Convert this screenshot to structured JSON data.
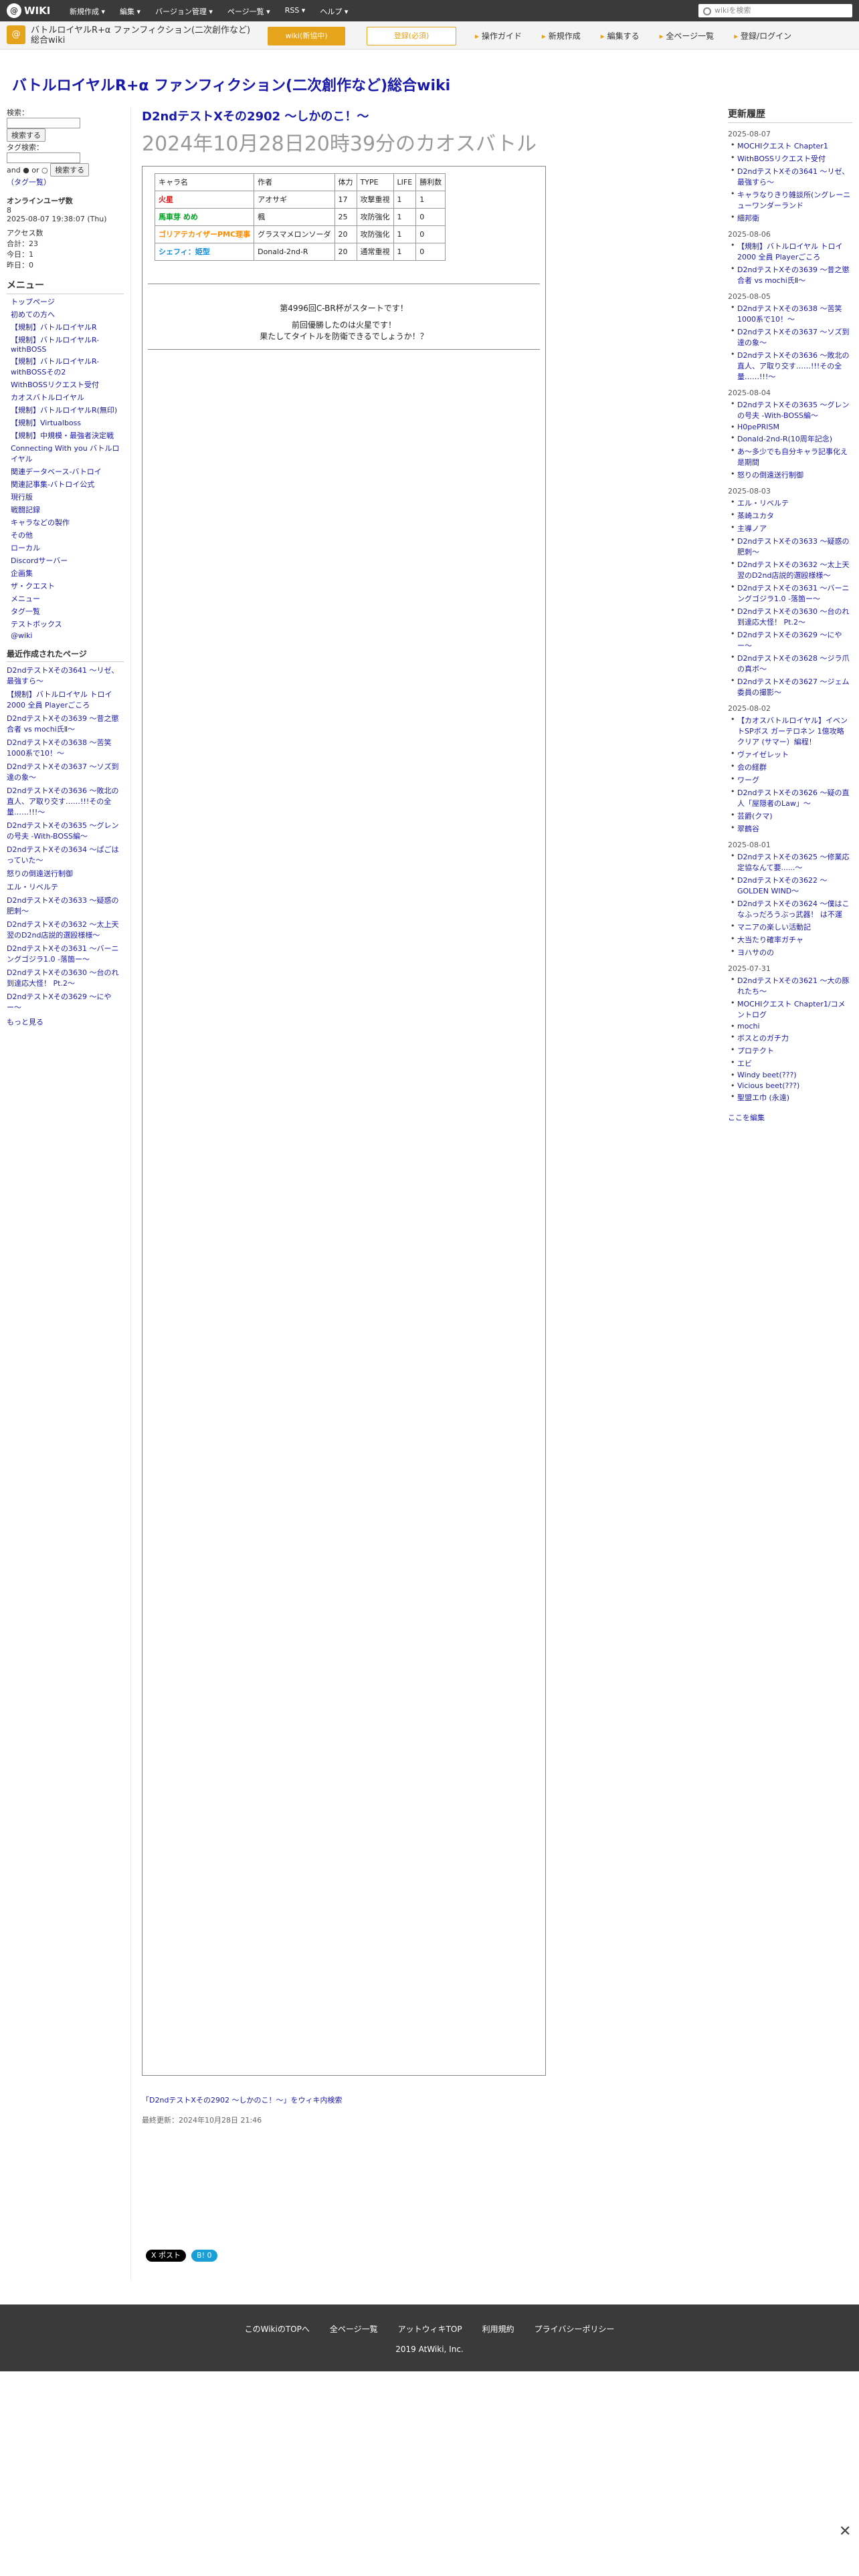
{
  "topbar": {
    "logo": "WIKI",
    "menus": [
      "新規作成 ▾",
      "編集 ▾",
      "バージョン管理 ▾",
      "ページ一覧 ▾",
      "RSS ▾",
      "ヘルプ ▾"
    ],
    "search_placeholder": "wikiを検索"
  },
  "subbar": {
    "site_title": "バトルロイヤルR+α ファンフィクション(二次創作など)総合wiki",
    "btn_wiki": "wiki(新協中)",
    "btn_register": "登録(必須)",
    "actions": [
      "操作ガイド",
      "新規作成",
      "編集する",
      "全ページ一覧",
      "登録/ログイン"
    ]
  },
  "wiki_title": "バトルロイヤルR+α ファンフィクション(二次創作など)総合wiki",
  "leftcol": {
    "search_label": "検索：",
    "search_btn": "検索する",
    "tag_label": "タグ検索：",
    "and_or": "and ● or ○",
    "search_btn2": "検索する",
    "tag_cloud": "（タグ一覧）",
    "online_label": "オンラインユーザ数",
    "online": "8",
    "date": "2025-08-07 19:38:07 (Thu)",
    "access": "アクセス数",
    "total": "合計：23",
    "today": "今日：1",
    "yesterday": "昨日：0",
    "menu_title": "メニュー",
    "nav": [
      "トップページ",
      "初めての方へ",
      "【規制】バトルロイヤルR",
      "【規制】バトルロイヤルR-withBOSS",
      "【規制】バトルロイヤルR-withBOSSその2",
      "WithBOSSリクエスト受付",
      "カオスバトルロイヤル",
      "【規制】バトルロイヤルR(無印)",
      "【規制】Virtualboss",
      "【規制】中規模・最強者決定戦",
      "Connecting With you バトルロイヤル",
      "関連データベース-バトロイ",
      "関連記事集-バトロイ公式",
      "現行版",
      "戦闘記録",
      "キャラなどの製作",
      "その他",
      "ローカル",
      "Discordサーバー",
      "企画集",
      "ザ・クエスト",
      "メニュー",
      "タグ一覧",
      "テストボックス",
      "@wiki"
    ],
    "recent_title": "最近作成されたページ",
    "recent": [
      "D2ndテストXその3641 〜リゼ、最強すら〜",
      "【規制】バトルロイヤル トロイ2000 全員 Playerごころ",
      "D2ndテストXその3639 〜昔之懲合者 vs mochi氏Ⅱ〜",
      "D2ndテストXその3638 〜苦笑1000系で10！〜",
      "D2ndテストXその3637 〜ソズ到達の象〜",
      "D2ndテストXその3636 〜敗北の直人、ア取り交す……!!!その全量……!!!〜",
      "D2ndテストXその3635 〜グレンの号夫 -With-BOSS編〜",
      "D2ndテストXその3634 〜ぱごはっていた〜",
      "怒りの倒遠送行制御",
      "エル・リベルテ",
      "D2ndテストXその3633 〜疑惑の肥刺〜",
      "D2ndテストXその3632 〜太上天翌のD2nd店説的選殴様様〜",
      "D2ndテストXその3631 〜バーニングゴジラ1.0 -落箇ー〜",
      "D2ndテストXその3630 〜台のれ到達応大怪！ Pt.2〜",
      "D2ndテストXその3629 〜にやー〜"
    ],
    "more": "もっと見る"
  },
  "main": {
    "page_sub": "D2ndテストXその2902 〜しかのこ！〜",
    "page_title": "2024年10月28日20時39分のカオスバトル",
    "table_headers": [
      "キャラ名",
      "作者",
      "体力",
      "TYPE",
      "LIFE",
      "勝利数"
    ],
    "table_rows": [
      [
        "火星",
        "アオサギ",
        "17",
        "攻撃重視",
        "1",
        "1"
      ],
      [
        "馬車芽 めめ",
        "楓",
        "25",
        "攻防強化",
        "1",
        "0"
      ],
      [
        "ゴリアテカイザーPMC理事",
        "グラスマメロンソーダ",
        "20",
        "攻防強化",
        "1",
        "0"
      ],
      [
        "シェフィ：姫型",
        "Donald-2nd-R",
        "20",
        "通常重視",
        "1",
        "0"
      ]
    ],
    "intro1": "第4996回C-BR杯がスタートです！",
    "intro2": "前回優勝したのは火星です！",
    "intro3": "果たしてタイトルを防衛できるでしょうか！？",
    "edit_link": "「D2ndテストXその2902 〜しかのこ！〜」をウィキ内検索",
    "updated": "最終更新：2024年10月28日 21:46",
    "share": [
      "X ポスト",
      "B! 0"
    ]
  },
  "rightcol": {
    "title": "更新履歴",
    "groups": [
      {
        "date": "2025-08-07",
        "items": [
          "MOCHIクエスト Chapter1",
          "WithBOSSリクエスト受付",
          "D2ndテストXその3641 〜リゼ、最強すら〜",
          "キャラなりきり雑談所(ングレーニューワンダーランド",
          "細邦衛"
        ]
      },
      {
        "date": "2025-08-06",
        "items": [
          "【規制】バトルロイヤル トロイ2000 全員 Playerごころ",
          "D2ndテストXその3639 〜昔之懲合者 vs mochi氏Ⅱ〜"
        ]
      },
      {
        "date": "2025-08-05",
        "items": [
          "D2ndテストXその3638 〜苦笑1000系で10！〜",
          "D2ndテストXその3637 〜ソズ到達の象〜",
          "D2ndテストXその3636 〜敗北の直人、ア取り交す……!!!その全量……!!!〜"
        ]
      },
      {
        "date": "2025-08-04",
        "items": [
          "D2ndテストXその3635 〜グレンの号夫 -With-BOSS編〜",
          "H0pePRISM",
          "Donald-2nd-R(10周年記念)",
          "あ〜多少でも自分キャラ記事化え是期間",
          "怒りの倒遠送行制御"
        ]
      },
      {
        "date": "2025-08-03",
        "items": [
          "エル・リベルテ",
          "蒸崎ユカタ",
          "主導ノア",
          "D2ndテストXその3633 〜疑惑の肥刺〜",
          "D2ndテストXその3632 〜太上天翌のD2nd店説的選殴様様〜",
          "D2ndテストXその3631 〜バーニングゴジラ1.0 -落箇ー〜",
          "D2ndテストXその3630 〜台のれ到達応大怪！ Pt.2〜",
          "D2ndテストXその3629 〜にやー〜",
          "D2ndテストXその3628 〜ジラ爪の真ボ〜",
          "D2ndテストXその3627 〜ジェム委員の撮影〜"
        ]
      },
      {
        "date": "2025-08-02",
        "items": [
          "【カオスバトルロイヤル】イベントSPボス ガーテロネン 1億攻略 クリア (サマー）編程！",
          "ヴァイゼレット",
          "会の経群",
          "ワーグ",
          "D2ndテストXその3626 〜疑の直人「屋隠者のLaw」〜",
          "芸爵(クマ)",
          "翠鶴谷"
        ]
      },
      {
        "date": "2025-08-01",
        "items": [
          "D2ndテストXその3625 〜修業応定協なんて要......〜",
          "D2ndテストXその3622 〜GOLDEN WIND〜",
          "D2ndテストXその3624 〜僕はこなふっだろうぶっ武器！ は不運",
          "マニアの楽しい活動記",
          "大当たり確率ガチャ",
          "ヨハサのの"
        ]
      },
      {
        "date": "2025-07-31",
        "items": [
          "D2ndテストXその3621 〜大の豚れたち〜",
          "MOCHIクエスト Chapter1/コメントログ",
          "mochi",
          "ボスとのガチ力",
          "プロテクト",
          "エビ",
          "Windy beet(???)",
          "Vicious beet(???)",
          "聖盟エ巾 (永遠)"
        ]
      }
    ],
    "edit": "ここを編集"
  },
  "footer": {
    "links": [
      "このWikiのTOPへ",
      "全ページ一覧",
      "アットウィキTOP",
      "利用規約",
      "プライバシーポリシー"
    ],
    "copy": "2019 AtWiki, Inc."
  }
}
